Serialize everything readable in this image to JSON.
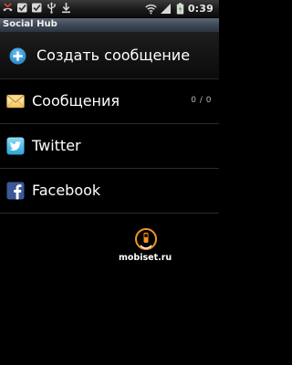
{
  "status_bar": {
    "time": "0:39",
    "left_icons": [
      "missed-call-icon",
      "checkbox-icon",
      "checkbox-icon",
      "usb-icon",
      "download-icon"
    ],
    "right_icons": [
      "wifi-icon",
      "signal-icon",
      "battery-icon"
    ]
  },
  "app": {
    "title": "Social Hub"
  },
  "compose": {
    "label": "Создать сообщение",
    "icon": "plus-circle-icon",
    "accent": "#3aa6e6"
  },
  "services": [
    {
      "label": "Сообщения",
      "count": "0 / 0",
      "icon": "envelope-icon"
    },
    {
      "label": "Twitter",
      "icon": "twitter-icon"
    },
    {
      "label": "Facebook",
      "icon": "facebook-icon"
    }
  ],
  "watermark": {
    "text": "mobiset.ru",
    "accent": "#f7941d"
  }
}
